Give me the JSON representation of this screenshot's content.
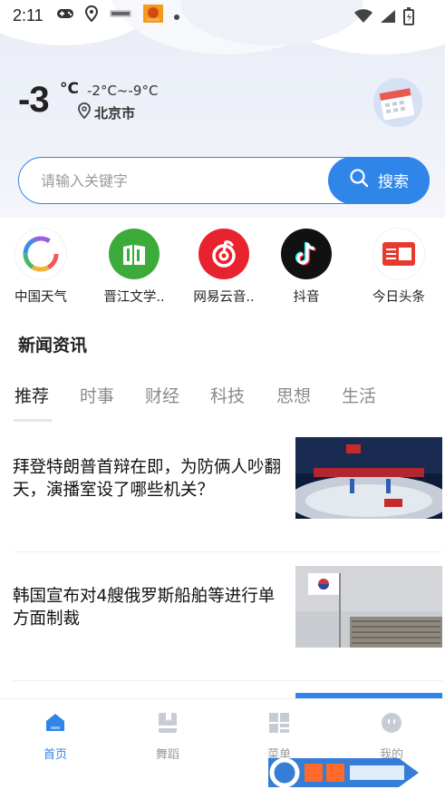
{
  "status_bar": {
    "time": "2:11"
  },
  "weather": {
    "temperature": "-3",
    "unit": "°C",
    "range": "-2°C~-9°C",
    "city": "北京市"
  },
  "search": {
    "placeholder": "请输入关键字",
    "button_label": "搜索"
  },
  "apps": [
    {
      "label": "中国天气",
      "icon": "china-weather-icon"
    },
    {
      "label": "晋江文学..",
      "icon": "jinjiang-literature-icon"
    },
    {
      "label": "网易云音..",
      "icon": "netease-music-icon"
    },
    {
      "label": "抖音",
      "icon": "douyin-icon"
    },
    {
      "label": "今日头条",
      "icon": "toutiao-icon"
    }
  ],
  "section": {
    "title": "新闻资讯"
  },
  "tabs": [
    {
      "label": "推荐",
      "active": true
    },
    {
      "label": "时事"
    },
    {
      "label": "财经"
    },
    {
      "label": "科技"
    },
    {
      "label": "思想"
    },
    {
      "label": "生活"
    }
  ],
  "news": [
    {
      "title": "拜登特朗普首辩在即，为防俩人吵翻天，演播室设了哪些机关？"
    },
    {
      "title": "韩国宣布对4艘俄罗斯船舶等进行单方面制裁"
    }
  ],
  "bottom_nav": [
    {
      "label": "首页",
      "icon": "home-icon",
      "active": true
    },
    {
      "label": "舞蹈",
      "icon": "book-icon"
    },
    {
      "label": "菜单",
      "icon": "grid-menu-icon"
    },
    {
      "label": "我的",
      "icon": "profile-icon"
    }
  ],
  "colors": {
    "accent": "#2f86e8"
  }
}
